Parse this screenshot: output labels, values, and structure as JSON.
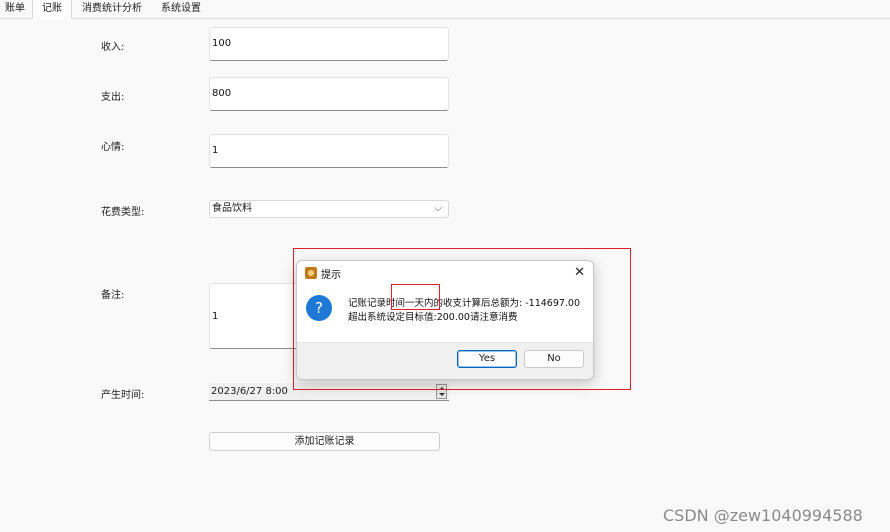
{
  "tabs": [
    {
      "label": "账单",
      "active": false
    },
    {
      "label": "记账",
      "active": true
    },
    {
      "label": "消费统计分析",
      "active": false
    },
    {
      "label": "系统设置",
      "active": false
    }
  ],
  "form": {
    "income_label": "收入:",
    "income_value": "100",
    "expense_label": "支出:",
    "expense_value": "800",
    "mood_label": "心情:",
    "mood_value": "1",
    "category_label": "花费类型:",
    "category_value": "食品饮料",
    "note_label": "备注:",
    "note_value": "1",
    "time_label": "产生时间:",
    "time_value": "2023/6/27 8:00",
    "add_button": "添加记账记录"
  },
  "dialog": {
    "title": "提示",
    "close": "✕",
    "icon": "?",
    "message_line1": "记账记录时间一天内的收支计算后总额为: -114697.00",
    "message_line2": "超出系统设定目标值:200.00请注意消费",
    "yes_label": "Yes",
    "no_label": "No"
  },
  "watermark": "CSDN @zew1040994588",
  "colors": {
    "highlight": "#e0202a",
    "accent": "#0067c0",
    "question_icon": "#1d78d6"
  }
}
